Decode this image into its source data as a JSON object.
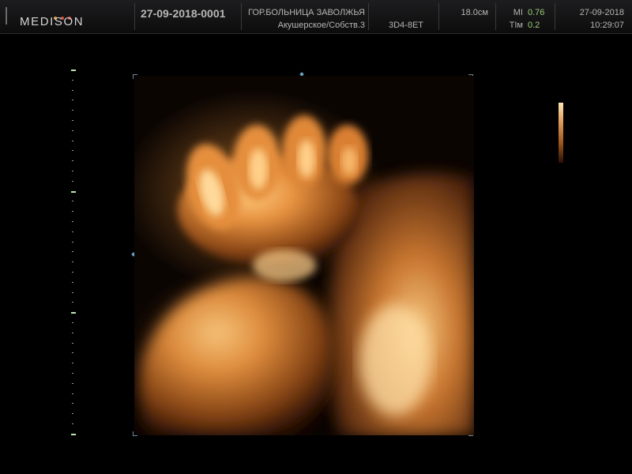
{
  "header": {
    "logo": "MEDISON",
    "logo_dot_colors": [
      "#d9a441",
      "#d9553f",
      "#d13d3d"
    ],
    "patient_id": "27-09-2018-0001",
    "hospital": "ГОР.БОЛЬНИЦА ЗАВОЛЖЬЯ",
    "preset": "Акушерское/Собств.3",
    "probe": "3D4-8ET",
    "depth": "18.0см",
    "mi_label": "MI",
    "mi_value": "0.76",
    "ti_label": "TIм",
    "ti_value": "0.2",
    "date": "27-09-2018",
    "time": "10:29:07"
  },
  "colors": {
    "accent_value": "#9ccf7a",
    "render_tint": "#e08a3a"
  }
}
